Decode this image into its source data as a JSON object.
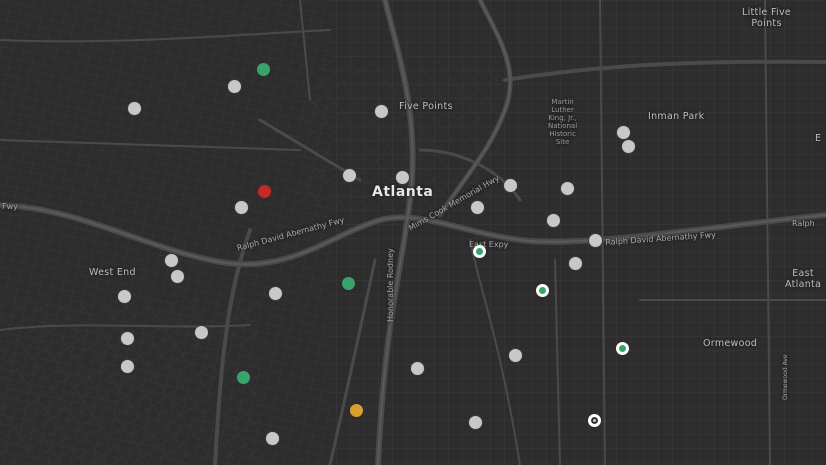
{
  "map": {
    "background": "#2c2c2c",
    "labels": {
      "atlanta": "Atlanta",
      "five_points": "Five Points",
      "west_end": "West End",
      "inman_park": "Inman Park",
      "ormewood": "Ormewood",
      "little_five_points_1": "Little Five",
      "little_five_points_2": "Points",
      "east_atlanta_1": "East",
      "east_atlanta_2": "Atlanta",
      "mlk_1": "Martin",
      "mlk_2": "Luther",
      "mlk_3": "King, Jr.,",
      "mlk_4": "National",
      "mlk_5": "Historic",
      "mlk_6": "Site",
      "ralph_abernathy_west": "Ralph David Abernathy Fwy",
      "ralph_abernathy_east": "Ralph David Abernathy Fwy",
      "ralph_edge": "Ralph",
      "fwy_edge": "Fwy",
      "east_expy": "East Expy",
      "mims_cook": "Mims Cook Memorial Hwy",
      "rodney_cook": "Honorable Rodney",
      "edge_e": "E",
      "ormewood_street": "Ormewood Ave"
    },
    "marker_colors": {
      "gray": "#c8c8c8",
      "green": "#3aa36b",
      "red": "#c62828",
      "orange": "#d9a030",
      "ring": "#ffffff"
    },
    "markers": [
      {
        "id": "m1",
        "kind": "green"
      },
      {
        "id": "m2",
        "kind": "gray"
      },
      {
        "id": "m3",
        "kind": "gray"
      },
      {
        "id": "m4",
        "kind": "gray"
      },
      {
        "id": "m5",
        "kind": "red"
      },
      {
        "id": "m6",
        "kind": "gray"
      },
      {
        "id": "m7",
        "kind": "gray"
      },
      {
        "id": "m8",
        "kind": "gray"
      },
      {
        "id": "m9",
        "kind": "gray"
      },
      {
        "id": "m10",
        "kind": "gray"
      },
      {
        "id": "m11",
        "kind": "gray"
      },
      {
        "id": "m12",
        "kind": "green"
      },
      {
        "id": "m13",
        "kind": "gray"
      },
      {
        "id": "m14",
        "kind": "gray"
      },
      {
        "id": "m15",
        "kind": "gray"
      },
      {
        "id": "m16",
        "kind": "gray"
      },
      {
        "id": "m17",
        "kind": "green"
      },
      {
        "id": "m18",
        "kind": "orange"
      },
      {
        "id": "m19",
        "kind": "gray"
      },
      {
        "id": "m20",
        "kind": "gray"
      },
      {
        "id": "m21",
        "kind": "gray"
      },
      {
        "id": "m22",
        "kind": "gray"
      },
      {
        "id": "m23",
        "kind": "gray"
      },
      {
        "id": "m24",
        "kind": "gray"
      },
      {
        "id": "m25",
        "kind": "green-ring"
      },
      {
        "id": "m26",
        "kind": "green-ring"
      },
      {
        "id": "m27",
        "kind": "gray"
      },
      {
        "id": "m28",
        "kind": "gray"
      },
      {
        "id": "m29",
        "kind": "gray"
      },
      {
        "id": "m30",
        "kind": "gray"
      },
      {
        "id": "m31",
        "kind": "gray"
      },
      {
        "id": "m32",
        "kind": "gray"
      },
      {
        "id": "m33",
        "kind": "gray"
      },
      {
        "id": "m34",
        "kind": "gray"
      },
      {
        "id": "m35",
        "kind": "green-ring"
      },
      {
        "id": "m36",
        "kind": "gray-ring"
      },
      {
        "id": "m37",
        "kind": "gray"
      }
    ]
  }
}
